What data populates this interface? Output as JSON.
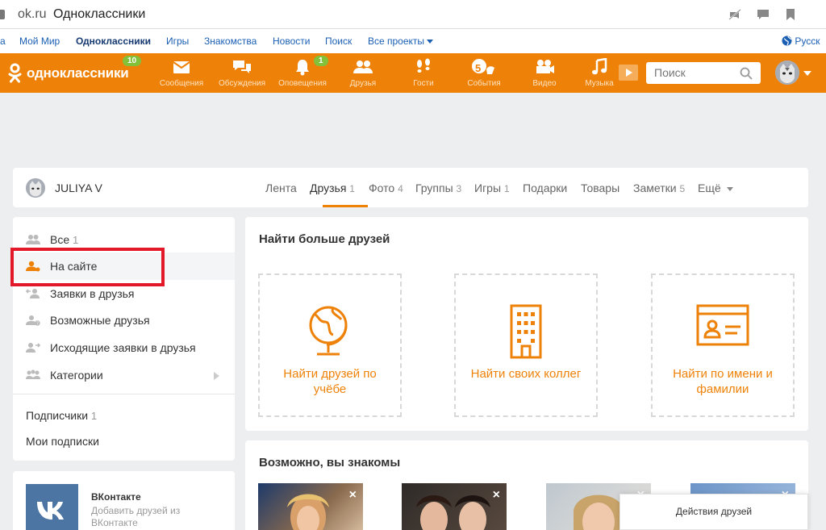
{
  "browser": {
    "domain": "ok.ru",
    "title": "Одноклассники"
  },
  "portal": {
    "items": [
      {
        "label": "а"
      },
      {
        "label": "Мой Мир"
      },
      {
        "label": "Одноклассники"
      },
      {
        "label": "Игры"
      },
      {
        "label": "Знакомства"
      },
      {
        "label": "Новости"
      },
      {
        "label": "Поиск"
      },
      {
        "label": "Все проекты"
      }
    ],
    "lang": "Русск"
  },
  "toolbar": {
    "logo": "одноклассники",
    "logo_badge": "10",
    "nav": [
      {
        "label": "Сообщения",
        "icon": "envelope-icon"
      },
      {
        "label": "Обсуждения",
        "icon": "chat-bubbles-icon"
      },
      {
        "label": "Оповещения",
        "icon": "bell-icon",
        "badge": "1"
      },
      {
        "label": "Друзья",
        "icon": "friends-icon"
      },
      {
        "label": "Гости",
        "icon": "footprints-icon"
      },
      {
        "label": "События",
        "icon": "events-icon",
        "badge": "5"
      },
      {
        "label": "Видео",
        "icon": "video-camera-icon"
      },
      {
        "label": "Музыка",
        "icon": "music-note-icon"
      }
    ],
    "search_placeholder": "Поиск"
  },
  "profile": {
    "name": "JULIYA V",
    "tabs": [
      {
        "label": "Лента",
        "count": ""
      },
      {
        "label": "Друзья",
        "count": "1"
      },
      {
        "label": "Фото",
        "count": "4"
      },
      {
        "label": "Группы",
        "count": "3"
      },
      {
        "label": "Игры",
        "count": "1"
      },
      {
        "label": "Подарки",
        "count": ""
      },
      {
        "label": "Товары",
        "count": ""
      },
      {
        "label": "Заметки",
        "count": "5"
      },
      {
        "label": "Ещё",
        "count": ""
      }
    ]
  },
  "leftmenu": {
    "items": [
      {
        "label": "Все",
        "count": "1"
      },
      {
        "label": "На сайте",
        "count": ""
      },
      {
        "label": "Заявки в друзья",
        "count": ""
      },
      {
        "label": "Возможные друзья",
        "count": ""
      },
      {
        "label": "Исходящие заявки в друзья",
        "count": ""
      },
      {
        "label": "Категории",
        "count": ""
      }
    ],
    "subscribers": {
      "label": "Подписчики",
      "count": "1"
    },
    "subscriptions": "Мои подписки"
  },
  "vk": {
    "title": "ВКонтакте",
    "subtitle": "Добавить друзей из ВКонтакте"
  },
  "find": {
    "title": "Найти больше друзей",
    "cards": [
      {
        "label": "Найти друзей по учёбе",
        "icon": "globe-icon"
      },
      {
        "label": "Найти своих коллег",
        "icon": "office-building-icon"
      },
      {
        "label": "Найти по имени и фамилии",
        "icon": "id-card-icon"
      }
    ]
  },
  "known": {
    "title": "Возможно, вы знакомы",
    "close": "×"
  },
  "actions_popup": "Действия друзей",
  "colors": {
    "brand": "#ee8208",
    "badge": "#83c13a",
    "link": "#1a5fb4",
    "highlight": "#e3192a"
  }
}
